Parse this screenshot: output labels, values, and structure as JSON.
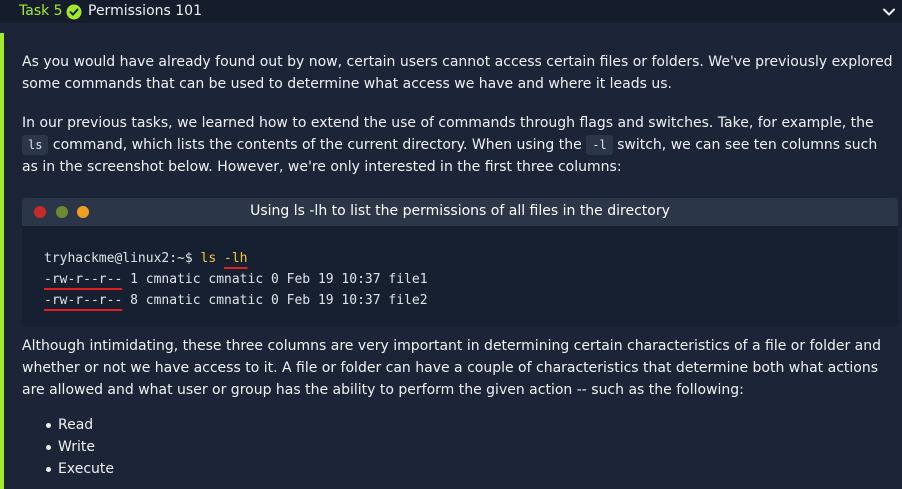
{
  "header": {
    "task_label": "Task 5",
    "title": "Permissions 101",
    "status": "completed",
    "accent_color": "#a3ea2a"
  },
  "body": {
    "para1": "As you would have already found out by now, certain users cannot access certain files or folders. We've previously explored some commands that can be used to determine what access we have and where it leads us.",
    "para2_before_ls": "In our previous tasks, we learned how to extend the use of commands through flags and switches. Take, for example, the ",
    "para2_code_ls": "ls",
    "para2_after_ls": " command, which lists the contents of the current directory. When using the ",
    "para2_code_l": "-l",
    "para2_after_l": " switch, we can see ten columns such as in the screenshot below. However, we're only interested in the first three columns:",
    "para3": "Although intimidating, these three columns are very important in determining certain characteristics of a file or folder and whether or not we have access to it. A file or folder can have a couple of characteristics that determine both what actions are allowed and what user or group has the ability to perform the given action -- such as the following:"
  },
  "terminal": {
    "title": "Using ls -lh to list the permissions of all files in the directory",
    "prompt": "tryhackme@linux2:~$",
    "cmd_ls": "ls",
    "cmd_flag": "-lh",
    "rows": [
      {
        "perms": "-rw-r--r--",
        "rest": " 1 cmnatic cmnatic 0 Feb 19 10:37 file1"
      },
      {
        "perms": "-rw-r--r--",
        "rest": " 8 cmnatic cmnatic 0 Feb 19 10:37 file2"
      }
    ]
  },
  "bullets": [
    "Read",
    "Write",
    "Execute"
  ]
}
